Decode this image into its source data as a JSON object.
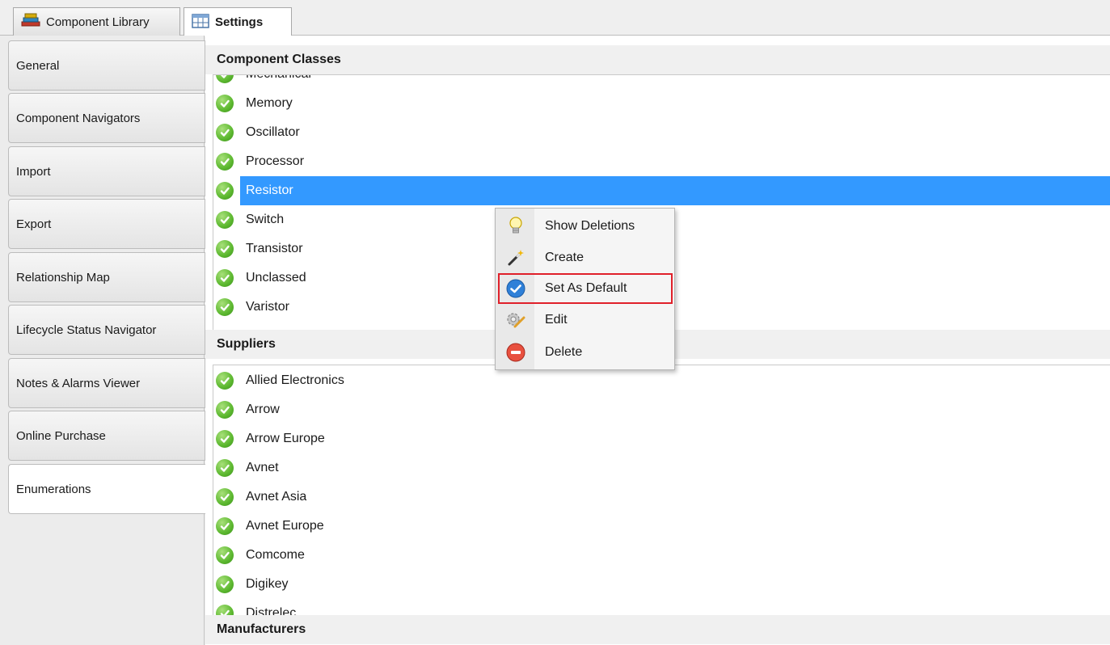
{
  "tabs": [
    {
      "label": "Component Library",
      "icon": "library-icon"
    },
    {
      "label": "Settings",
      "icon": "settings-table-icon"
    }
  ],
  "sidebar": {
    "items": [
      {
        "label": "General"
      },
      {
        "label": "Component Navigators"
      },
      {
        "label": "Import"
      },
      {
        "label": "Export"
      },
      {
        "label": "Relationship Map"
      },
      {
        "label": "Lifecycle Status Navigator"
      },
      {
        "label": "Notes & Alarms Viewer"
      },
      {
        "label": "Online Purchase"
      },
      {
        "label": "Enumerations"
      }
    ],
    "active": "Enumerations"
  },
  "component_classes": {
    "title": "Component Classes",
    "items": [
      "Mechanical",
      "Memory",
      "Oscillator",
      "Processor",
      "Resistor",
      "Switch",
      "Transistor",
      "Unclassed",
      "Varistor"
    ],
    "selected": "Resistor"
  },
  "suppliers": {
    "title": "Suppliers",
    "items": [
      "Allied Electronics",
      "Arrow",
      "Arrow Europe",
      "Avnet",
      "Avnet Asia",
      "Avnet Europe",
      "Comcome",
      "Digikey",
      "Distrelec"
    ]
  },
  "manufacturers": {
    "title": "Manufacturers"
  },
  "context_menu": {
    "items": [
      {
        "label": "Show Deletions",
        "icon": "lightbulb-icon"
      },
      {
        "label": "Create",
        "icon": "magic-wand-icon"
      },
      {
        "label": "Set As Default",
        "icon": "blue-check-icon"
      },
      {
        "label": "Edit",
        "icon": "gear-pencil-icon"
      },
      {
        "label": "Delete",
        "icon": "red-minus-icon"
      }
    ],
    "highlighted": "Set As Default"
  },
  "colors": {
    "selection": "#3399ff",
    "check_green": "#5cb82f",
    "highlight_border": "#e0202a"
  }
}
